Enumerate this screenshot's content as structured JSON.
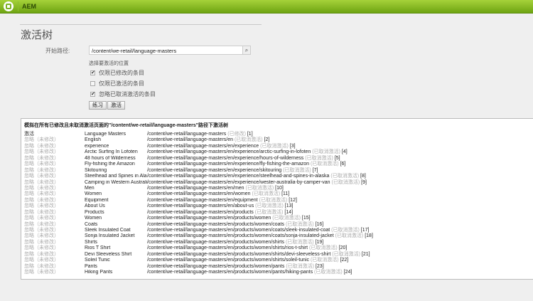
{
  "app": {
    "brand": "AEM"
  },
  "page": {
    "title": "激活树",
    "start_path_label": "开始路径:",
    "start_path_value": "/content/we-retail/language-masters",
    "select_label": "选择要激活的位置",
    "options": [
      {
        "label": "仅限已修改的条目",
        "checked": true
      },
      {
        "label": "仅限已激活的条目",
        "checked": false
      },
      {
        "label": "忽略已取消激活的条目",
        "checked": true
      }
    ],
    "dry_run_label": "练习",
    "activate_label": "激活"
  },
  "results": {
    "title": "模拟在所有已修改且未取消激活页面的\"/content/we-retail/language-masters\"路径下激活树",
    "rows": [
      {
        "action": "激活",
        "title": "Language Masters",
        "path": "/content/we-retail/language-masters",
        "status": "(已修改)",
        "index": "[1]"
      },
      {
        "action": "忽略（未修改）",
        "title": "English",
        "path": "/content/we-retail/language-masters/en",
        "status": "(已取消激活)",
        "index": "[2]"
      },
      {
        "action": "忽略（未修改）",
        "title": "experience",
        "path": "/content/we-retail/language-masters/en/experience",
        "status": "(已取消激活)",
        "index": "[3]"
      },
      {
        "action": "忽略（未修改）",
        "title": "Arctic Surfing In Lofoten",
        "path": "/content/we-retail/language-masters/en/experience/arctic-surfing-in-lofoten",
        "status": "(已取消激活)",
        "index": "[4]"
      },
      {
        "action": "忽略（未修改）",
        "title": "48 hours of Wilderness",
        "path": "/content/we-retail/language-masters/en/experience/hours-of-wilderness",
        "status": "(已取消激活)",
        "index": "[5]"
      },
      {
        "action": "忽略（未修改）",
        "title": "Fly-fishing the Amazon",
        "path": "/content/we-retail/language-masters/en/experience/fly-fishing-the-amazon",
        "status": "(已取消激活)",
        "index": "[6]"
      },
      {
        "action": "忽略（未修改）",
        "title": "Skitouring",
        "path": "/content/we-retail/language-masters/en/experience/skitouring",
        "status": "(已取消激活)",
        "index": "[7]"
      },
      {
        "action": "忽略（未修改）",
        "title": "Steelhead and Spines in Alaska",
        "path": "/content/we-retail/language-masters/en/experience/steelhead-and-spines-in-alaska",
        "status": "(已取消激活)",
        "index": "[8]"
      },
      {
        "action": "忽略（未修改）",
        "title": "Camping in Western Australia",
        "path": "/content/we-retail/language-masters/en/experience/wester-australia-by-camper-van",
        "status": "(已取消激活)",
        "index": "[9]"
      },
      {
        "action": "忽略（未修改）",
        "title": "Men",
        "path": "/content/we-retail/language-masters/en/men",
        "status": "(已取消激活)",
        "index": "[10]"
      },
      {
        "action": "忽略（未修改）",
        "title": "Women",
        "path": "/content/we-retail/language-masters/en/women",
        "status": "(已取消激活)",
        "index": "[11]"
      },
      {
        "action": "忽略（未修改）",
        "title": "Equipment",
        "path": "/content/we-retail/language-masters/en/equipment",
        "status": "(已取消激活)",
        "index": "[12]"
      },
      {
        "action": "忽略（未修改）",
        "title": "About Us",
        "path": "/content/we-retail/language-masters/en/about-us",
        "status": "(已取消激活)",
        "index": "[13]"
      },
      {
        "action": "忽略（未修改）",
        "title": "Products",
        "path": "/content/we-retail/language-masters/en/products",
        "status": "(已取消激活)",
        "index": "[14]"
      },
      {
        "action": "忽略（未修改）",
        "title": "Women",
        "path": "/content/we-retail/language-masters/en/products/women",
        "status": "(已取消激活)",
        "index": "[15]"
      },
      {
        "action": "忽略（未修改）",
        "title": "Coats",
        "path": "/content/we-retail/language-masters/en/products/women/coats",
        "status": "(已取消激活)",
        "index": "[16]"
      },
      {
        "action": "忽略（未修改）",
        "title": "Sleek Insulated Coat",
        "path": "/content/we-retail/language-masters/en/products/women/coats/sleek-insulated-coat",
        "status": "(已取消激活)",
        "index": "[17]"
      },
      {
        "action": "忽略（未修改）",
        "title": "Sonja Insulated Jacket",
        "path": "/content/we-retail/language-masters/en/products/women/coats/sonja-insulated-jacket",
        "status": "(已取消激活)",
        "index": "[18]"
      },
      {
        "action": "忽略（未修改）",
        "title": "Shirts",
        "path": "/content/we-retail/language-masters/en/products/women/shirts",
        "status": "(已取消激活)",
        "index": "[19]"
      },
      {
        "action": "忽略（未修改）",
        "title": "Rios T Shirt",
        "path": "/content/we-retail/language-masters/en/products/women/shirts/rios-t-shirt",
        "status": "(已取消激活)",
        "index": "[20]"
      },
      {
        "action": "忽略（未修改）",
        "title": "Devi Sleeveless Shirt",
        "path": "/content/we-retail/language-masters/en/products/women/shirts/devi-sleeveless-shirt",
        "status": "(已取消激活)",
        "index": "[21]"
      },
      {
        "action": "忽略（未修改）",
        "title": "Soleil Tunic",
        "path": "/content/we-retail/language-masters/en/products/women/shirts/soleil-tunic",
        "status": "(已取消激活)",
        "index": "[22]"
      },
      {
        "action": "忽略（未修改）",
        "title": "Pants",
        "path": "/content/we-retail/language-masters/en/products/women/pants",
        "status": "(已取消激活)",
        "index": "[23]"
      },
      {
        "action": "忽略（未修改）",
        "title": "Hiking Pants",
        "path": "/content/we-retail/language-masters/en/products/women/pants/hiking-pants",
        "status": "(已取消激活)",
        "index": "[24]"
      }
    ]
  }
}
